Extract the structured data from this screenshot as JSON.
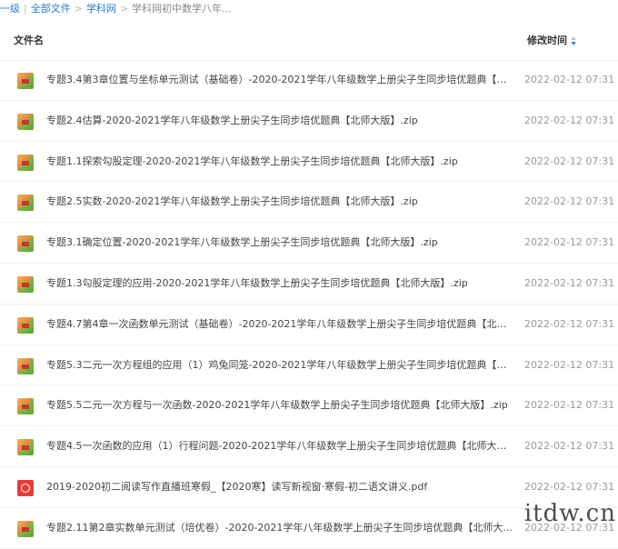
{
  "breadcrumb": {
    "back": "一级",
    "all_files": "全部文件",
    "folder": "学科网",
    "current": "学科网初中数学八年..."
  },
  "table": {
    "col_name": "文件名",
    "col_time": "修改时间"
  },
  "files": [
    {
      "name": "专题3.4第3章位置与坐标单元测试（基础卷）-2020-2021学年八年级数学上册尖子生同步培优题典【北师...",
      "time": "2022-02-12 07:31",
      "icon": "zip-icon"
    },
    {
      "name": "专题2.4估算-2020-2021学年八年级数学上册尖子生同步培优题典【北师大版】.zip",
      "time": "2022-02-12 07:31",
      "icon": "zip-icon"
    },
    {
      "name": "专题1.1探索勾股定理-2020-2021学年八年级数学上册尖子生同步培优题典【北师大版】.zip",
      "time": "2022-02-12 07:31",
      "icon": "zip-icon"
    },
    {
      "name": "专题2.5实数-2020-2021学年八年级数学上册尖子生同步培优题典【北师大版】.zip",
      "time": "2022-02-12 07:31",
      "icon": "zip-icon"
    },
    {
      "name": "专题3.1确定位置-2020-2021学年八年级数学上册尖子生同步培优题典【北师大版】.zip",
      "time": "2022-02-12 07:31",
      "icon": "zip-icon"
    },
    {
      "name": "专题1.3勾股定理的应用-2020-2021学年八年级数学上册尖子生同步培优题典【北师大版】.zip",
      "time": "2022-02-12 07:31",
      "icon": "zip-icon"
    },
    {
      "name": "专题4.7第4章一次函数单元测试（基础卷）-2020-2021学年八年级数学上册尖子生同步培优题典【北师大...",
      "time": "2022-02-12 07:31",
      "icon": "zip-icon"
    },
    {
      "name": "专题5.3二元一次方程组的应用（1）鸡兔同笼-2020-2021学年八年级数学上册尖子生同步培优题典【北师...",
      "time": "2022-02-12 07:31",
      "icon": "zip-icon"
    },
    {
      "name": "专题5.5二元一次方程与一次函数-2020-2021学年八年级数学上册尖子生同步培优题典【北师大版】.zip",
      "time": "2022-02-12 07:31",
      "icon": "zip-icon"
    },
    {
      "name": "专题4.5一次函数的应用（1）行程问题-2020-2021学年八年级数学上册尖子生同步培优题典【北师大版】...",
      "time": "2022-02-12 07:31",
      "icon": "zip-icon"
    },
    {
      "name": "2019-2020初二阅读写作直播班寒假_【2020寒】读写新视窗·寒假-初二语文讲义.pdf",
      "time": "2022-02-12 07:31",
      "icon": "pdf-icon"
    },
    {
      "name": "专题2.11第2章实数单元测试（培优卷）-2020-2021学年八年级数学上册尖子生同步培优题典【北师大...",
      "time": "2022-02-12 07:31",
      "icon": "zip-icon"
    }
  ],
  "watermark": "itdw.cn"
}
